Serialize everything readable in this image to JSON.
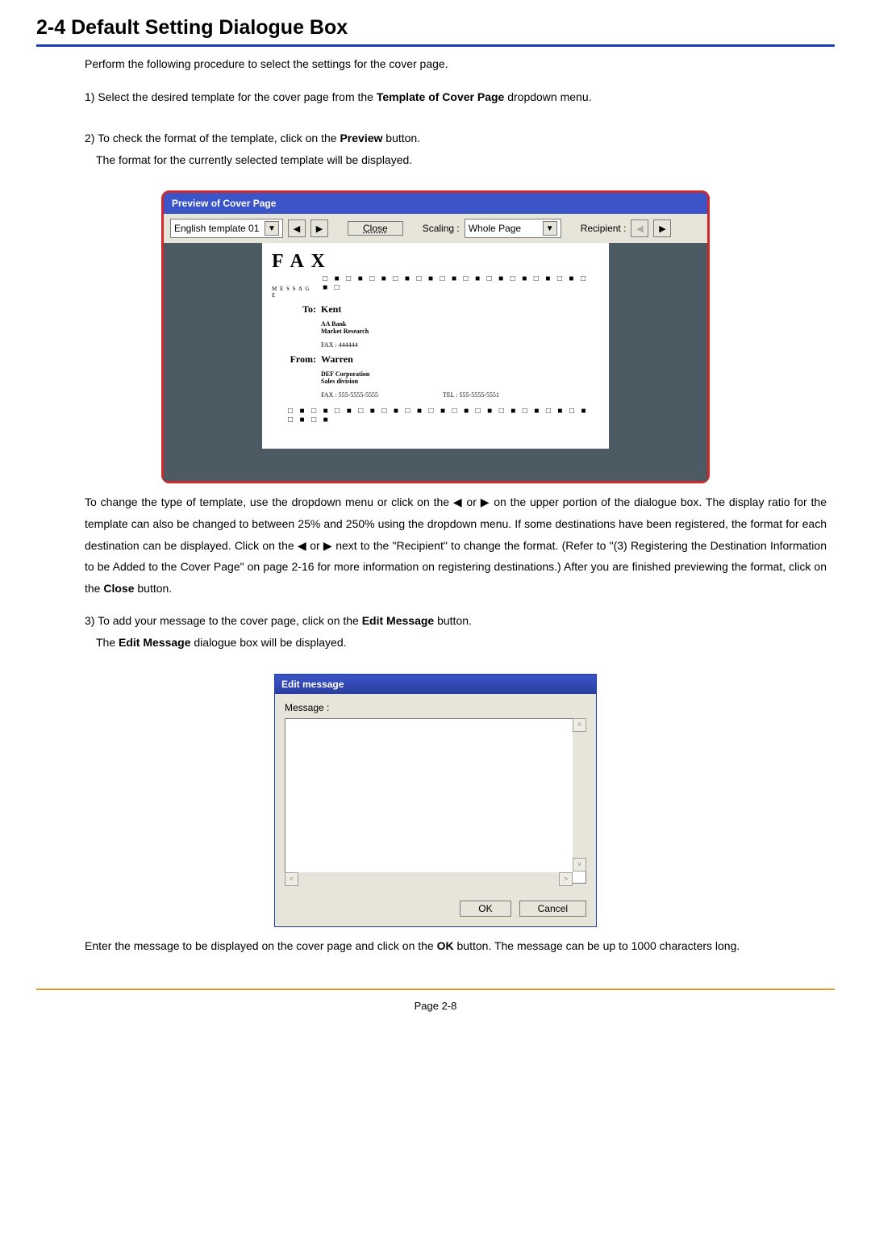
{
  "heading": "2-4  Default Setting Dialogue Box",
  "intro": "Perform the following procedure to select the settings for the cover page.",
  "step1_a": "1) Select the desired template for the cover page from the ",
  "step1_b": "Template of Cover Page",
  "step1_c": " dropdown menu.",
  "step2_a": "2) To check the format of the template, click on the ",
  "step2_b": "Preview",
  "step2_c": " button.",
  "step2_note": "The format for the currently selected template will be displayed.",
  "preview": {
    "title": "Preview of Cover Page",
    "template_selected": "English template 01",
    "close_label": "Close",
    "scaling_label": "Scaling :",
    "scaling_value": "Whole Page",
    "recipient_label": "Recipient :"
  },
  "fax": {
    "title": "F A X",
    "sub": "M E S S A G E",
    "to_label": "To:",
    "to_name": "Kent",
    "to_company": "AA Bank",
    "to_dept": "Market Research",
    "to_fax": "FAX : 444444",
    "from_label": "From:",
    "from_name": "Warren",
    "from_company": "DEF Corporation",
    "from_dept": "Sales division",
    "from_fax": "FAX : 555-5555-5555",
    "from_tel": "TEL : 555-5555-5551"
  },
  "after_preview_a": "To change the type of template, use the dropdown menu or click on the ◀ or ▶ on the upper portion of the dialogue box. The display ratio for the template can also be changed to between 25% and 250% using the dropdown menu. If some destinations have been registered, the format for each destination can be displayed. Click on the ◀ or ▶ next to the \"Recipient\" to change the format. (Refer to \"(3) Registering the Destination Information to be Added to the Cover Page\" on page 2-16 for more information on registering destinations.) After you are finished previewing the format, click on the ",
  "after_preview_b": "Close",
  "after_preview_c": " button.",
  "step3_a": "3) To add your message to the cover page, click on the ",
  "step3_b": "Edit Message",
  "step3_c": " button.",
  "step3_note_a": "The ",
  "step3_note_b": "Edit Message",
  "step3_note_c": " dialogue box will be displayed.",
  "editmsg": {
    "title": "Edit message",
    "label": "Message :",
    "ok": "OK",
    "cancel": "Cancel"
  },
  "after_edit_a": "Enter the message to be displayed on the cover page and click on the ",
  "after_edit_b": "OK",
  "after_edit_c": " button. The message can be up to 1000 characters long.",
  "page_number": "Page 2-8"
}
